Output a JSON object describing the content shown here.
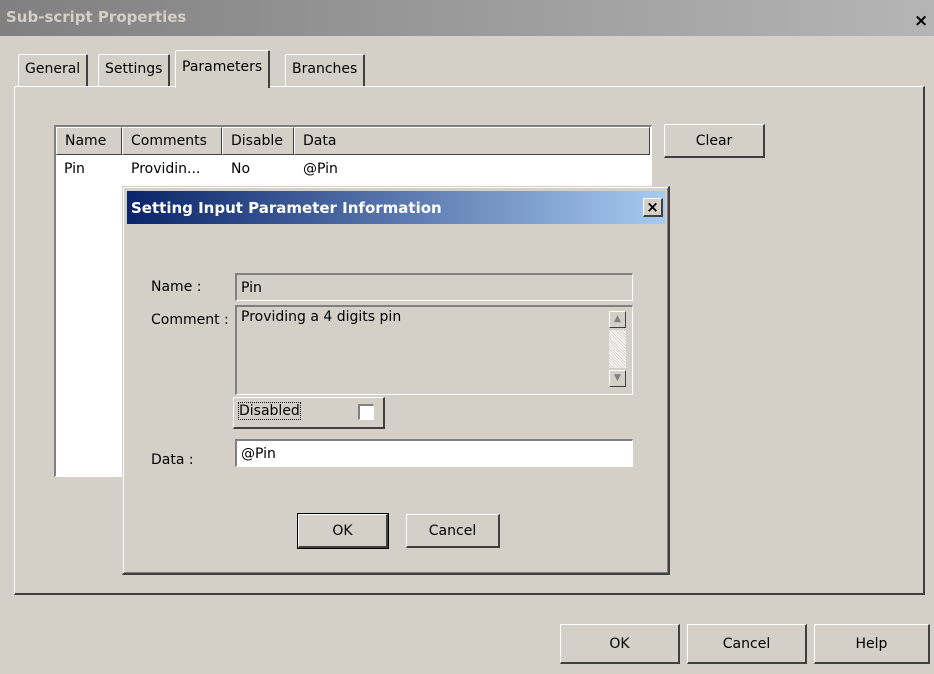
{
  "window": {
    "title": "Sub-script Properties",
    "close_glyph": "×"
  },
  "tabs": [
    {
      "label": "General"
    },
    {
      "label": "Settings"
    },
    {
      "label": "Parameters",
      "active": true
    },
    {
      "label": "Branches"
    }
  ],
  "parameter_list": {
    "columns": [
      "Name",
      "Comments",
      "Disable",
      "Data"
    ],
    "rows": [
      {
        "name": "Pin",
        "comments": "Providin...",
        "disable": "No",
        "data": "@Pin"
      }
    ],
    "clear_label": "Clear"
  },
  "dialog": {
    "title": "Setting Input Parameter Information",
    "close_glyph": "×",
    "name_label": "Name :",
    "name_value": "Pin",
    "comment_label": "Comment :",
    "comment_value": "Providing a 4 digits pin",
    "disabled_label": "Disabled",
    "disabled_checked": false,
    "data_label": "Data :",
    "data_value": "@Pin",
    "ok_label": "OK",
    "cancel_label": "Cancel"
  },
  "footer": {
    "ok_label": "OK",
    "cancel_label": "Cancel",
    "help_label": "Help"
  },
  "colors": {
    "inner_title_start": "#0a246a",
    "inner_title_end": "#a6caf0",
    "inactive_title": "#808080",
    "face": "#d4d0c8"
  }
}
